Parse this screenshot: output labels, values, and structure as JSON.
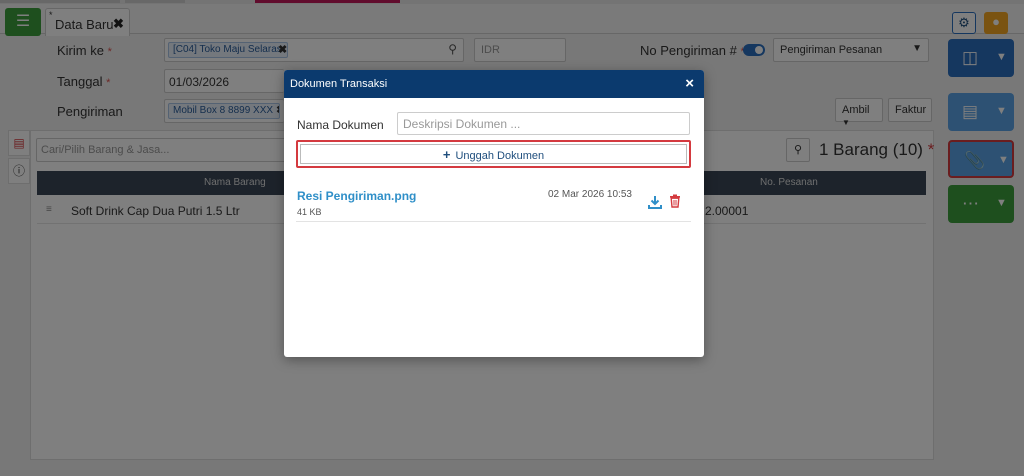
{
  "tabs": {
    "active_label": "Data Baru",
    "modified_mark": "*"
  },
  "colors": {
    "modal_header": "#0b3a6e",
    "highlight": "#d43a3f",
    "link": "#2f8fc8",
    "save_blue": "#2a6ebf",
    "green": "#3d9e3d"
  },
  "form": {
    "kirim_ke_label": "Kirim ke",
    "kirim_ke_value": "[C04] Toko Maju Selaras",
    "currency": "IDR",
    "no_pengiriman_label": "No Pengiriman #",
    "pengiriman_type": "Pengiriman Pesanan",
    "tanggal_label": "Tanggal",
    "tanggal_value": "01/03/2026",
    "pengiriman_label": "Pengiriman",
    "pengiriman_value": "Mobil Box 8 8899 XXX",
    "ambil_button": "Ambil",
    "faktur_button": "Faktur",
    "required_mark": "*"
  },
  "items": {
    "search_placeholder": "Cari/Pilih Barang & Jasa...",
    "count_label": "1 Barang (10)",
    "required_mark": "*",
    "col_nama_barang": "Nama Barang",
    "col_no_pesanan": "No. Pesanan",
    "row_nama": "Soft Drink Cap Dua Putri 1.5 Ltr",
    "row_no_pesanan": "2.00001"
  },
  "modal": {
    "title": "Dokumen Transaksi",
    "close_icon": "×",
    "nama_dokumen_label": "Nama Dokumen",
    "deskripsi_placeholder": "Deskripsi Dokumen ...",
    "upload_label": "Unggah Dokumen",
    "file": {
      "name": "Resi Pengiriman.png",
      "size": "41 KB",
      "date": "02 Mar 2026 10:53"
    }
  },
  "icons": {
    "menu": "list-icon",
    "settings": "gear-icon",
    "bulb": "lightbulb-icon",
    "save": "floppy-disk-icon",
    "document": "document-icon",
    "attachment": "paperclip-icon",
    "more": "more-options-icon",
    "search": "search-icon",
    "download": "download-icon",
    "delete": "trash-icon"
  }
}
